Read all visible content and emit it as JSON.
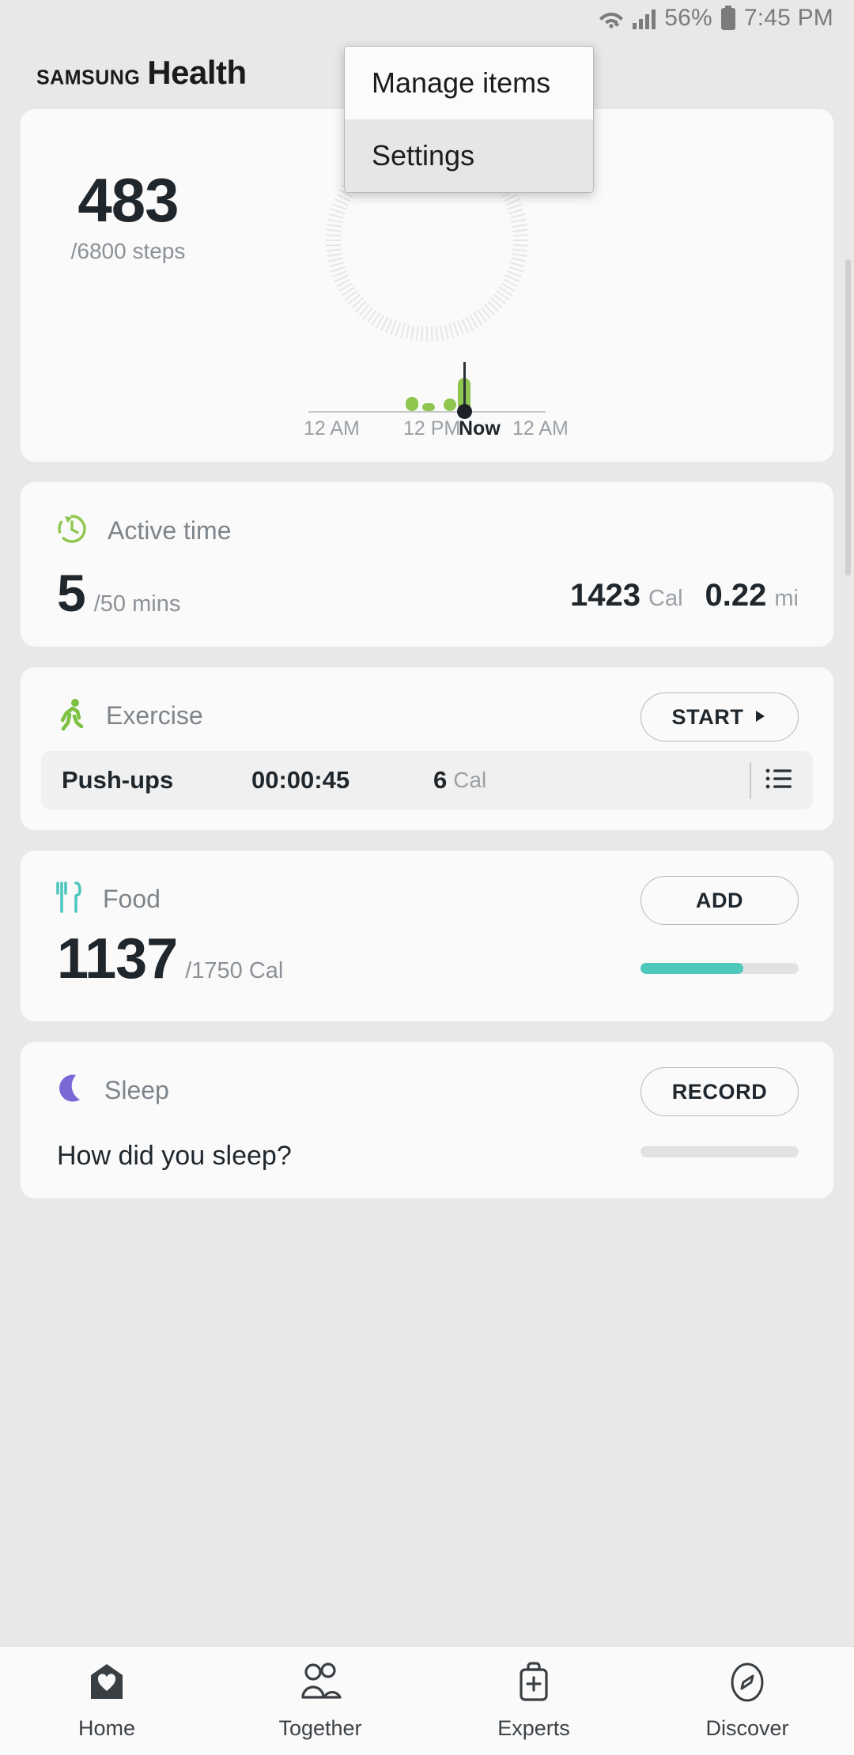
{
  "statusbar": {
    "wifi_icon": "wifi-icon",
    "signal_icon": "cellular-signal-icon",
    "battery_percent": "56%",
    "battery_icon": "battery-icon",
    "time": "7:45 PM"
  },
  "header": {
    "brand": "SAMSUNG",
    "app_name": "Health",
    "more_menu": {
      "items": [
        {
          "label": "Manage items",
          "selected": false
        },
        {
          "label": "Settings",
          "selected": true
        }
      ]
    }
  },
  "steps_card": {
    "value": "483",
    "goal_text": "/6800 steps",
    "goal": 6800,
    "progress_percent": 7.1,
    "ring_color": "#8fc64f",
    "ring_track_color": "#e6e6e6",
    "chart": {
      "axis_labels": [
        "12 AM",
        "12 PM",
        "Now",
        "12 AM"
      ],
      "now_label": "Now",
      "bars": [
        {
          "x_percent": 41,
          "height": 18
        },
        {
          "x_percent": 48,
          "height": 10
        },
        {
          "x_percent": 57,
          "height": 16
        },
        {
          "x_percent": 63,
          "height": 42
        }
      ]
    }
  },
  "active_time_card": {
    "icon": "active-time-clock-icon",
    "title": "Active time",
    "value": "5",
    "unit": "/50 mins",
    "calories": "1423",
    "calories_unit": "Cal",
    "distance": "0.22",
    "distance_unit": "mi"
  },
  "exercise_card": {
    "icon": "running-person-icon",
    "title": "Exercise",
    "button_label": "START",
    "button_icon": "play-triangle-icon",
    "entry": {
      "name": "Push-ups",
      "duration": "00:00:45",
      "calories": "6",
      "calories_unit": "Cal",
      "list_icon": "list-icon"
    }
  },
  "food_card": {
    "icon": "fork-knife-icon",
    "title": "Food",
    "button_label": "ADD",
    "value": "1137",
    "goal_text": "/1750 Cal",
    "progress_percent": 65,
    "progress_color": "#4ec7bd"
  },
  "sleep_card": {
    "icon": "moon-icon",
    "title": "Sleep",
    "button_label": "RECORD",
    "question": "How did you sleep?",
    "progress_percent": 0
  },
  "bottom_nav": {
    "items": [
      {
        "label": "Home",
        "icon": "home-heart-icon",
        "active": true
      },
      {
        "label": "Together",
        "icon": "people-icon",
        "active": false
      },
      {
        "label": "Experts",
        "icon": "medical-bag-icon",
        "active": false
      },
      {
        "label": "Discover",
        "icon": "compass-icon",
        "active": false
      }
    ]
  }
}
